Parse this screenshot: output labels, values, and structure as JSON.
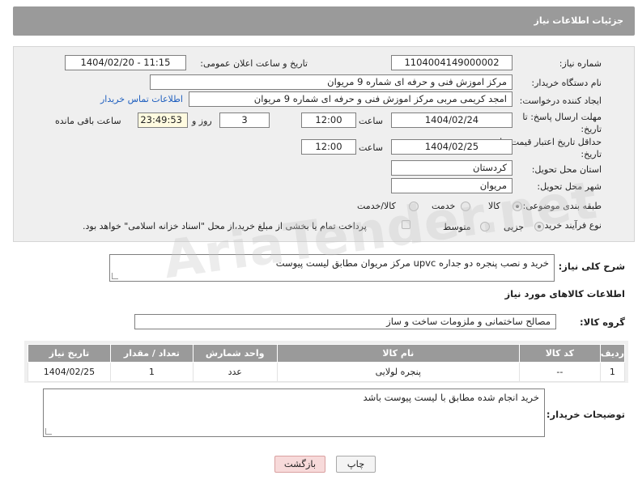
{
  "header": {
    "title": "جزئیات اطلاعات نیاز"
  },
  "form": {
    "need_number_label": "شماره نیاز:",
    "need_number": "1104004149000002",
    "announce_label": "تاریخ و ساعت اعلان عمومی:",
    "announce_value": "1404/02/20 - 11:15",
    "buyer_org_label": "نام دستگاه خریدار:",
    "buyer_org": "مرکز اموزش فنی و حرفه ای شماره 9 مریوان",
    "requester_label": "ایجاد کننده درخواست:",
    "requester": "امجد کریمی مربی مرکز اموزش فنی و حرفه ای شماره 9 مریوان",
    "contact_link": "اطلاعات تماس خریدار",
    "reply_deadline_label": "مهلت ارسال پاسخ: تا تاریخ:",
    "reply_date": "1404/02/24",
    "time_label": "ساعت",
    "reply_time": "12:00",
    "days_value": "3",
    "days_label": "روز و",
    "remaining_time": "23:49:53",
    "remaining_label": "ساعت باقی مانده",
    "price_validity_label": "حداقل تاریخ اعتبار قیمت: تا تاریخ:",
    "validity_date": "1404/02/25",
    "validity_time_label": "ساعت",
    "validity_time": "12:00",
    "province_label": "استان محل تحویل:",
    "province": "کردستان",
    "city_label": "شهر محل تحویل:",
    "city": "مریوان",
    "category_label": "طبقه بندی موضوعی:",
    "category_options": [
      "کالا",
      "خدمت",
      "کالا/خدمت"
    ],
    "category_selected": "کالا",
    "process_label": "نوع فرآیند خرید :",
    "process_options": [
      "جزیی",
      "متوسط"
    ],
    "process_selected": "جزیی",
    "payment_note": "پرداخت تمام یا بخشی از مبلغ خرید،از محل \"اسناد خزانه اسلامی\" خواهد بود."
  },
  "description": {
    "label": "شرح کلی نیاز:",
    "text": "خرید و نصب پنجره دو جداره upvc مرکز مریوان مطابق لیست پیوست"
  },
  "goods_info_title": "اطلاعات کالاهای مورد نیاز",
  "goods_group": {
    "label": "گروه کالا:",
    "value": "مصالح ساختمانی و ملزومات ساخت و ساز"
  },
  "table": {
    "headers": [
      "ردیف",
      "کد کالا",
      "نام کالا",
      "واحد شمارش",
      "تعداد / مقدار",
      "تاریخ نیاز"
    ],
    "rows": [
      [
        "1",
        "--",
        "پنجره لولایی",
        "عدد",
        "1",
        "1404/02/25"
      ]
    ]
  },
  "buyer_notes": {
    "label": "توضیحات خریدار:",
    "text": "خرید انجام شده مطابق با لیست پیوست باشد"
  },
  "buttons": {
    "print": "چاپ",
    "back": "بازگشت"
  },
  "watermark": "AriaTender.net"
}
